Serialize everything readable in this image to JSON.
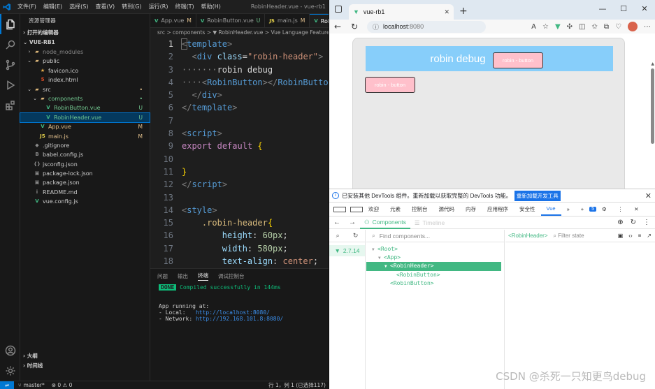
{
  "vscode": {
    "window_title": "RobinHeader.vue - vue-rb1",
    "menu": [
      "文件(F)",
      "编辑(E)",
      "选择(S)",
      "查看(V)",
      "转到(G)",
      "运行(R)",
      "终端(T)",
      "帮助(H)"
    ],
    "sidebar": {
      "title": "资源管理器",
      "open_editors": "打开的编辑器",
      "project": "VUE-RB1",
      "tree": [
        {
          "label": "node_modules",
          "icon": "",
          "type": "folder-closed",
          "indent": 1,
          "dim": true,
          "badge": ""
        },
        {
          "label": "public",
          "icon": "",
          "type": "folder-open",
          "indent": 1,
          "badge": ""
        },
        {
          "label": "favicon.ico",
          "icon": "★",
          "type": "file",
          "indent": 2,
          "badge": ""
        },
        {
          "label": "index.html",
          "icon": "5",
          "type": "file",
          "indent": 2,
          "badge": ""
        },
        {
          "label": "src",
          "icon": "",
          "type": "folder-open",
          "indent": 1,
          "badge": "•"
        },
        {
          "label": "components",
          "icon": "",
          "type": "folder-open",
          "indent": 2,
          "badge": "•",
          "color": "u"
        },
        {
          "label": "RobinButton.vue",
          "icon": "V",
          "type": "file",
          "indent": 3,
          "badge": "U",
          "color": "u"
        },
        {
          "label": "RobinHeader.vue",
          "icon": "V",
          "type": "file",
          "indent": 3,
          "badge": "U",
          "color": "u",
          "selected": true
        },
        {
          "label": "App.vue",
          "icon": "V",
          "type": "file",
          "indent": 2,
          "badge": "M",
          "color": "m"
        },
        {
          "label": "main.js",
          "icon": "JS",
          "type": "file",
          "indent": 2,
          "badge": "M",
          "color": "m"
        },
        {
          "label": ".gitignore",
          "icon": "◆",
          "type": "file",
          "indent": 1,
          "badge": ""
        },
        {
          "label": "babel.config.js",
          "icon": "B",
          "type": "file",
          "indent": 1,
          "badge": ""
        },
        {
          "label": "jsconfig.json",
          "icon": "{}",
          "type": "file",
          "indent": 1,
          "badge": ""
        },
        {
          "label": "package-lock.json",
          "icon": "▣",
          "type": "file",
          "indent": 1,
          "badge": ""
        },
        {
          "label": "package.json",
          "icon": "▣",
          "type": "file",
          "indent": 1,
          "badge": ""
        },
        {
          "label": "README.md",
          "icon": "i",
          "type": "file",
          "indent": 1,
          "badge": ""
        },
        {
          "label": "vue.config.js",
          "icon": "V",
          "type": "file",
          "indent": 1,
          "badge": ""
        }
      ],
      "outline": "大纲",
      "timeline": "时间线"
    },
    "tabs": [
      {
        "icon": "V",
        "label": "App.vue",
        "badge": "M",
        "active": false
      },
      {
        "icon": "V",
        "label": "RobinButton.vue",
        "badge": "U",
        "active": false
      },
      {
        "icon": "JS",
        "label": "main.js",
        "badge": "M",
        "active": false
      },
      {
        "icon": "V",
        "label": "RobinHeader.vue",
        "badge": "U",
        "active": true
      }
    ],
    "breadcrumb": "src > components > ▼ RobinHeader.vue > Vue Language Features (",
    "panel_tabs": [
      "问题",
      "输出",
      "终端",
      "调试控制台"
    ],
    "panel_active": "终端",
    "terminal": {
      "done": "DONE",
      "compiled": "Compiled successfully in 144ms",
      "running": "App running at:",
      "local_label": "- Local:   ",
      "local_url": "http://localhost:8080/",
      "network_label": "- Network: ",
      "network_url": "http://192.168.101.8:8080/"
    },
    "status": {
      "branch": "master*",
      "problems": "⊗ 0  ⚠ 0",
      "cursor": "行 1，列 1 (已选择117)"
    }
  },
  "browser": {
    "tab_title": "vue-rb1",
    "url_host": "localhost",
    "url_port": ":8080",
    "page": {
      "header_text": "robin debug",
      "button_label_header": "robin - button",
      "button_label_standalone": "robin - button",
      "header_color": "#87cefa",
      "button_color": "#ffc0cb"
    },
    "devtools": {
      "info": "已安装其他 DevTools 组件。重新加载以获取完整的 DevTools 功能。",
      "reload_btn": "重新加载开发工具",
      "tabs": [
        "欢迎",
        "元素",
        "控制台",
        "源代码",
        "内存",
        "应用程序",
        "安全性",
        "Vue"
      ],
      "active_tab": "Vue",
      "badge": "5",
      "vue": {
        "components_tab": "Components",
        "timeline_tab": "Timeline",
        "version": "2.7.14",
        "find_placeholder": "Find components...",
        "selected_component": "<RobinHeader>",
        "filter_placeholder": "Filter state",
        "tree": [
          {
            "label": "<Root>",
            "depth": 0,
            "arrow": "▼"
          },
          {
            "label": "<App>",
            "depth": 1,
            "arrow": "▼"
          },
          {
            "label": "<RobinHeader>",
            "depth": 2,
            "arrow": "▼",
            "selected": true
          },
          {
            "label": "<RobinButton>",
            "depth": 3,
            "arrow": ""
          },
          {
            "label": "<RobinButton>",
            "depth": 2,
            "arrow": ""
          }
        ]
      }
    }
  },
  "watermark": "CSDN @杀死一只知更鸟debug"
}
